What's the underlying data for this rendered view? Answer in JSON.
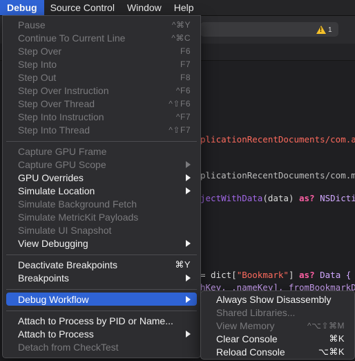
{
  "menubar": {
    "items": [
      "Debug",
      "Source Control",
      "Window",
      "Help"
    ]
  },
  "toolbar": {
    "warning_count": "1"
  },
  "code": {
    "line1": "plicationRecentDocuments/com.a",
    "line2": "plicationRecentDocuments/com.m",
    "line3_a": "jectWithData",
    "line3_b": "(data) ",
    "line3_c": "as?",
    "line3_d": " NSDicti",
    "line4_a": "= dict[",
    "line4_b": "\"Bookmark\"",
    "line4_c": "] ",
    "line4_d": "as?",
    "line4_e": " Data {",
    "line5": "hKey, .nameKey], fromBookmarkD"
  },
  "debug_menu": {
    "items": [
      {
        "label": "Pause",
        "shortcut": "^⌘Y"
      },
      {
        "label": "Continue To Current Line",
        "shortcut": "^⌘C"
      },
      {
        "label": "Step Over",
        "shortcut": "F6"
      },
      {
        "label": "Step Into",
        "shortcut": "F7"
      },
      {
        "label": "Step Out",
        "shortcut": "F8"
      },
      {
        "label": "Step Over Instruction",
        "shortcut": "^F6"
      },
      {
        "label": "Step Over Thread",
        "shortcut": "^⇧F6"
      },
      {
        "label": "Step Into Instruction",
        "shortcut": "^F7"
      },
      {
        "label": "Step Into Thread",
        "shortcut": "^⇧F7"
      },
      {
        "label": "Capture GPU Frame"
      },
      {
        "label": "Capture GPU Scope"
      },
      {
        "label": "GPU Overrides"
      },
      {
        "label": "Simulate Location"
      },
      {
        "label": "Simulate Background Fetch"
      },
      {
        "label": "Simulate MetricKit Payloads"
      },
      {
        "label": "Simulate UI Snapshot"
      },
      {
        "label": "View Debugging"
      },
      {
        "label": "Deactivate Breakpoints",
        "shortcut": "⌘Y"
      },
      {
        "label": "Breakpoints"
      },
      {
        "label": "Debug Workflow"
      },
      {
        "label": "Attach to Process by PID or Name..."
      },
      {
        "label": "Attach to Process"
      },
      {
        "label": "Detach from CheckTest"
      }
    ]
  },
  "submenu": {
    "items": [
      {
        "label": "Always Show Disassembly"
      },
      {
        "label": "Shared Libraries..."
      },
      {
        "label": "View Memory",
        "shortcut": "^⌥⇧⌘M"
      },
      {
        "label": "Clear Console",
        "shortcut": "⌘K"
      },
      {
        "label": "Reload Console",
        "shortcut": "⌥⌘K"
      }
    ]
  },
  "colors": {
    "accent": "#2f63d4",
    "menu_bg": "#2d2d30",
    "disabled_text": "#7a7a7d",
    "string": "#fc6a5d",
    "keyword": "#fc5fa3"
  }
}
